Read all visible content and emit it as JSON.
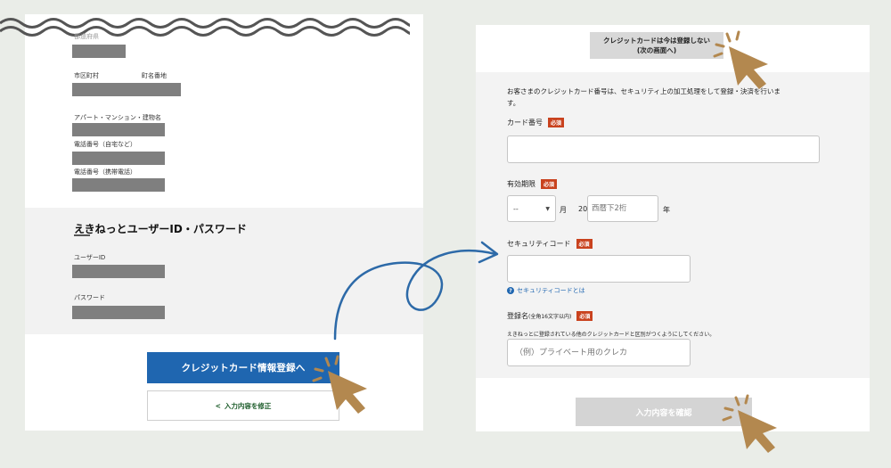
{
  "left_form": {
    "fields": {
      "prefecture_label": "都道府県",
      "city_label": "市区町村",
      "town_label": "町名番地",
      "building_label": "アパート・マンション・建物名",
      "phone_home_label": "電話番号（自宅など）",
      "phone_mobile_label": "電話番号（携帯電話）"
    },
    "account_section": {
      "title": "えきねっとユーザーID・パスワード",
      "user_id_label": "ユーザーID",
      "password_label": "パスワード"
    },
    "register_card_button": "クレジットカード情報登録へ",
    "edit_input_link": "入力内容を修正",
    "edit_chevron": "<"
  },
  "right_form": {
    "skip_button_line1": "クレジットカードは今は登録しない",
    "skip_button_line2": "(次の画面へ)",
    "intro_text_line1": "お客さまのクレジットカード番号は、セキュリティ上の加工処理をして登録・決済を行いま",
    "intro_text_line2": "す。",
    "required_badge": "必須",
    "card_number_label": "カード番号",
    "expiry_label": "有効期限",
    "month_select_value": "--",
    "month_suffix": "月",
    "year_prefix": "20",
    "year_placeholder": "西暦下2桁",
    "year_suffix": "年",
    "security_code_label": "セキュリティコード",
    "security_help_link": "セキュリティコードとは",
    "help_icon_glyph": "?",
    "registration_name_label": "登録名",
    "registration_name_note": "(全角16文字以内)",
    "registration_name_help": "えきねっとに登録されている他のクレジットカードと区別がつくようにしてください。",
    "registration_name_placeholder": "（例）プライベート用のクレカ",
    "confirm_button": "入力内容を確認"
  },
  "colors": {
    "background": "#eaede8",
    "primary_blue": "#1f66b0",
    "required_red": "#c9421e",
    "pointer_brown": "#b3884f",
    "curve_blue": "#2d6aa8"
  },
  "icons": [
    "pointing-hand-icon",
    "click-sparkle-icon",
    "curved-arrow-icon",
    "wavy-cut-icon",
    "question-circle-icon",
    "select-caret-icon"
  ]
}
